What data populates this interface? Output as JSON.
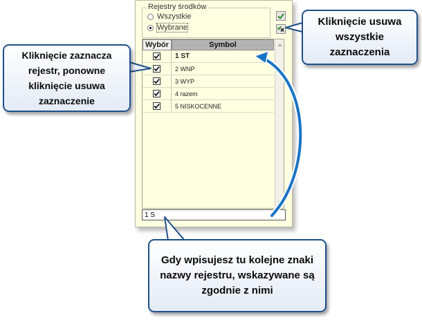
{
  "panel": {
    "group_title": "Rejestry środków",
    "radio_options": [
      {
        "label": "Wszystkie",
        "checked": false
      },
      {
        "label": "Wybrane",
        "checked": true
      }
    ],
    "select_all_icon": "checkmark-icon",
    "clear_all_icon": "uncheck-all-icon"
  },
  "grid": {
    "columns": [
      "Wybór",
      "Symbol"
    ],
    "rows": [
      {
        "checked": true,
        "symbol": "1 ST"
      },
      {
        "checked": true,
        "symbol": "2 WNP"
      },
      {
        "checked": true,
        "symbol": "3 WYP"
      },
      {
        "checked": true,
        "symbol": "4 razem"
      },
      {
        "checked": true,
        "symbol": "5 NISKOCENNE"
      }
    ]
  },
  "search": {
    "value": "1 S"
  },
  "callouts": {
    "left": "Kliknięcie zaznacza\nrejestr, ponowne\nkliknięcie usuwa\nzaznaczenie",
    "right": "Kliknięcie usuwa\nwszystkie\nzaznaczenia",
    "bottom": "Gdy wpisujesz tu kolejne znaki\nnazwy rejestru, wskazywane są\nzgodnie z nimi"
  },
  "colors": {
    "panel_bg": "#ffffe1",
    "callout_border": "#1d4f8a",
    "arrow": "#1a74c4",
    "toolbar_green": "#2e8b2e"
  }
}
